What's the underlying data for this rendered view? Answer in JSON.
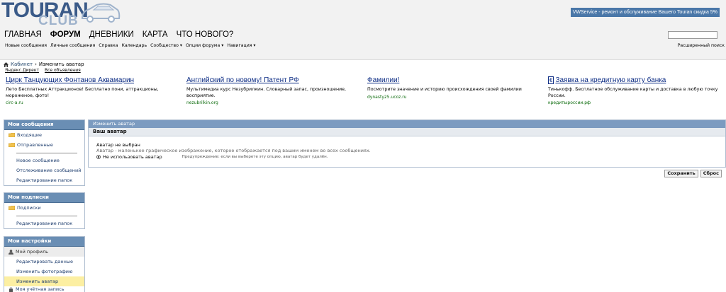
{
  "logo": {
    "main": "TOURAN",
    "sub": "CLUB"
  },
  "promo": {
    "text": "VWService - ремонт и обслуживание Вашего Touran скидка 5%"
  },
  "main_nav": [
    {
      "label": "ГЛАВНАЯ",
      "active": false
    },
    {
      "label": "ФОРУМ",
      "active": true
    },
    {
      "label": "ДНЕВНИКИ",
      "active": false
    },
    {
      "label": "КАРТА",
      "active": false
    },
    {
      "label": "ЧТО НОВОГО?",
      "active": false
    }
  ],
  "sub_nav": [
    "Новые сообщения",
    "Личные сообщения",
    "Справка",
    "Календарь",
    "Сообщество ▾",
    "Опции форума ▾",
    "Навигация ▾"
  ],
  "advanced_search": "Расширенный поиск",
  "breadcrumb": {
    "root": "Кабинет",
    "separator": "›",
    "current": "Изменить аватар"
  },
  "yandex": {
    "label": "Яндекс.Директ",
    "all_ads": "Все объявления"
  },
  "ads": [
    {
      "title": "Цирк Танцующих Фонтанов Аквамарин",
      "desc": "Лето Бесплатных Аттракционов! Бесплатно пони, аттракционы, мороженое, фото!",
      "url": "circ-a.ru",
      "badge": false
    },
    {
      "title": "Английский по новому! Патент РФ",
      "desc": "Мультимедиа курс Незубрилкин. Словарный запас, произношение, восприятие.",
      "url": "nezubrilkin.org",
      "badge": false
    },
    {
      "title": "Фамилии!",
      "desc": "Посмотрите значение и историю происхождения своей фамилии",
      "url": "dynasty25.ucoz.ru",
      "badge": false
    },
    {
      "title": "Заявка на кредитную карту банка",
      "desc": "Тинькофф. Бесплатное обслуживание карты и доставка в любую точку России.",
      "url": "кредитыроссии.рф",
      "badge": true,
      "badge_text": "€"
    }
  ],
  "sidebar": {
    "messages": {
      "title": "Мои сообщения",
      "inbox": "Входящие",
      "sent": "Отправленные",
      "new_message": "Новое сообщение",
      "tracking": "Отслеживание сообщений",
      "edit_folders": "Редактирование папок"
    },
    "subscriptions": {
      "title": "Мои подписки",
      "subs": "Подписки",
      "edit_folders": "Редактирование папок"
    },
    "settings": {
      "title": "Мои настройки",
      "profile": "Мой профиль",
      "edit_data": "Редактировать данные",
      "change_photo": "Изменить фотографию",
      "change_avatar": "Изменить аватар",
      "next_partial": "Моя учётная запись"
    }
  },
  "panel": {
    "header": "Изменить аватар",
    "subheader": "Ваш аватар",
    "no_avatar": "Аватар не выбран",
    "desc": "Аватар - маленькое графическое изображение, которое отображается под вашим именем во всех сообщениях.",
    "option": "Не использовать аватар",
    "warning": "Предупреждение: если вы выберете эту опцию, аватар будет удалён."
  },
  "buttons": {
    "save": "Сохранить",
    "reset": "Сброс"
  },
  "colors": {
    "header_bg": "#6a8eb4",
    "panel_header": "#7c9bc0",
    "promo_bg": "#4a77a8",
    "highlight": "#fcefa2",
    "link": "#0c2c84"
  }
}
